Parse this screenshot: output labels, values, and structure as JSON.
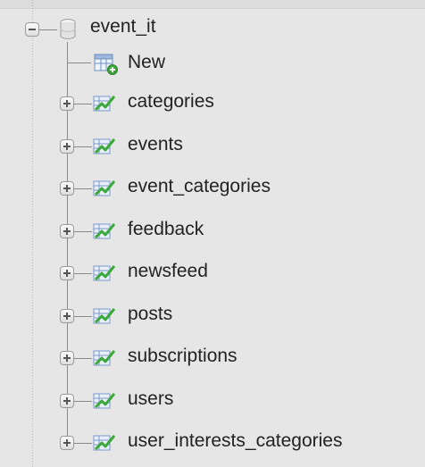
{
  "database": {
    "name": "event_it",
    "icon": "database-icon",
    "expanded": true
  },
  "new_item": {
    "label": "New",
    "icon": "new-table-icon"
  },
  "tables": [
    {
      "label": "categories"
    },
    {
      "label": "events"
    },
    {
      "label": "event_categories"
    },
    {
      "label": "feedback"
    },
    {
      "label": "newsfeed"
    },
    {
      "label": "posts"
    },
    {
      "label": "subscriptions"
    },
    {
      "label": "users"
    },
    {
      "label": "user_interests_categories"
    }
  ],
  "table_icon": "table-icon",
  "colors": {
    "background": "#e6e6e6",
    "tree_line": "#8a8a8a",
    "table_icon_green": "#3aa83a",
    "table_icon_blue": "#5f87c6"
  }
}
